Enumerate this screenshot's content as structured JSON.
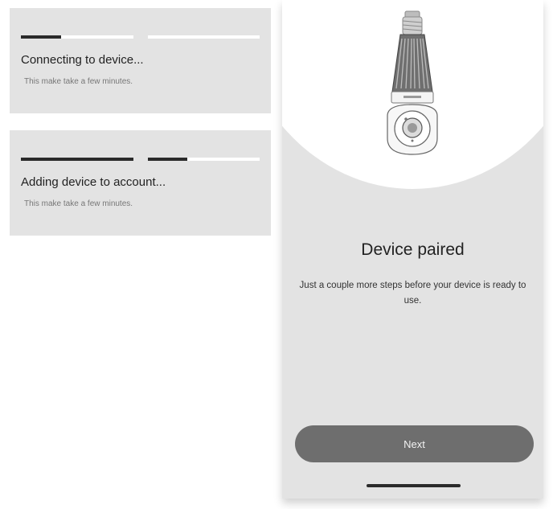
{
  "status_cards": [
    {
      "title": "Connecting to device...",
      "subtitle": "This make take a few minutes.",
      "progress": [
        0.36,
        0.0
      ]
    },
    {
      "title": "Adding device to account...",
      "subtitle": "This make take a few minutes.",
      "progress": [
        1.0,
        0.35
      ]
    }
  ],
  "paired_screen": {
    "title": "Device paired",
    "description": "Just a couple more steps before your device is ready to use.",
    "next_label": "Next",
    "illustration": "camera-bulb-icon"
  },
  "colors": {
    "card_bg": "#e3e3e3",
    "progress_fill": "#2a2a2a",
    "progress_track": "#ffffff",
    "button_bg": "#6e6e6e"
  }
}
